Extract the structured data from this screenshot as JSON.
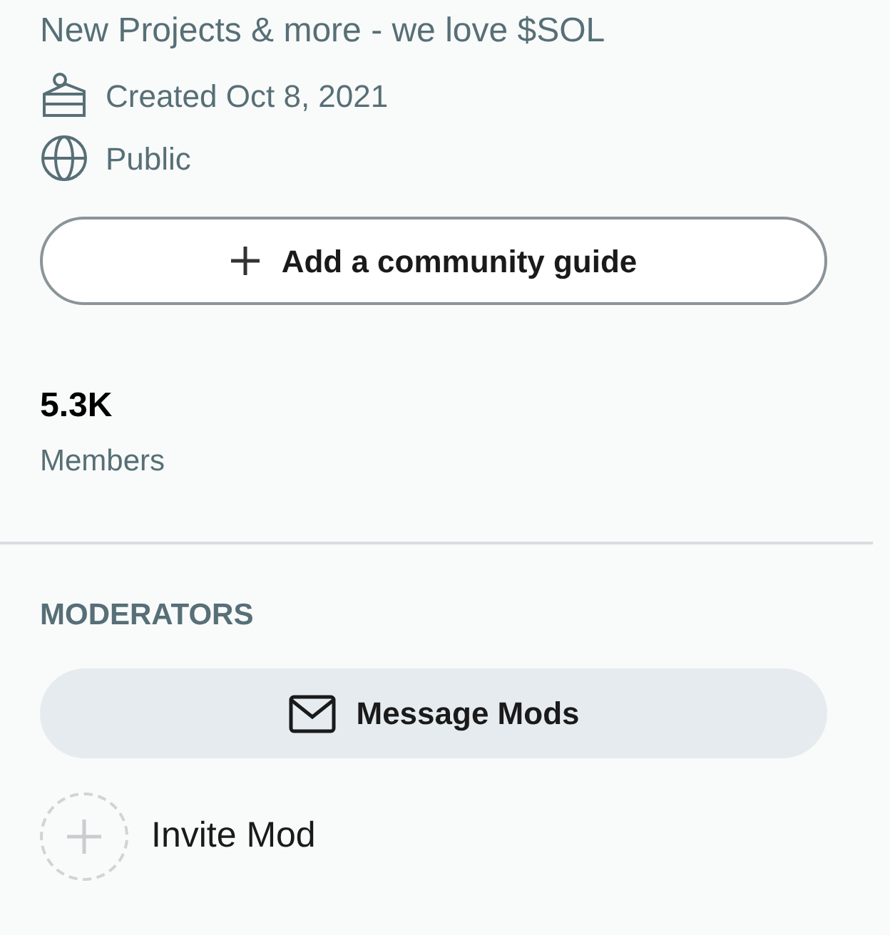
{
  "description": "New Projects & more - we love $SOL",
  "meta": [
    {
      "kind": "created",
      "label": "Created Oct 8, 2021"
    },
    {
      "kind": "visibility",
      "label": "Public"
    }
  ],
  "guide_button": {
    "label": "Add a community guide"
  },
  "stats": [
    {
      "value": "5.3K",
      "label": "Members"
    }
  ],
  "moderators": {
    "heading": "MODERATORS",
    "message_button": "Message Mods",
    "invite": "Invite Mod"
  }
}
